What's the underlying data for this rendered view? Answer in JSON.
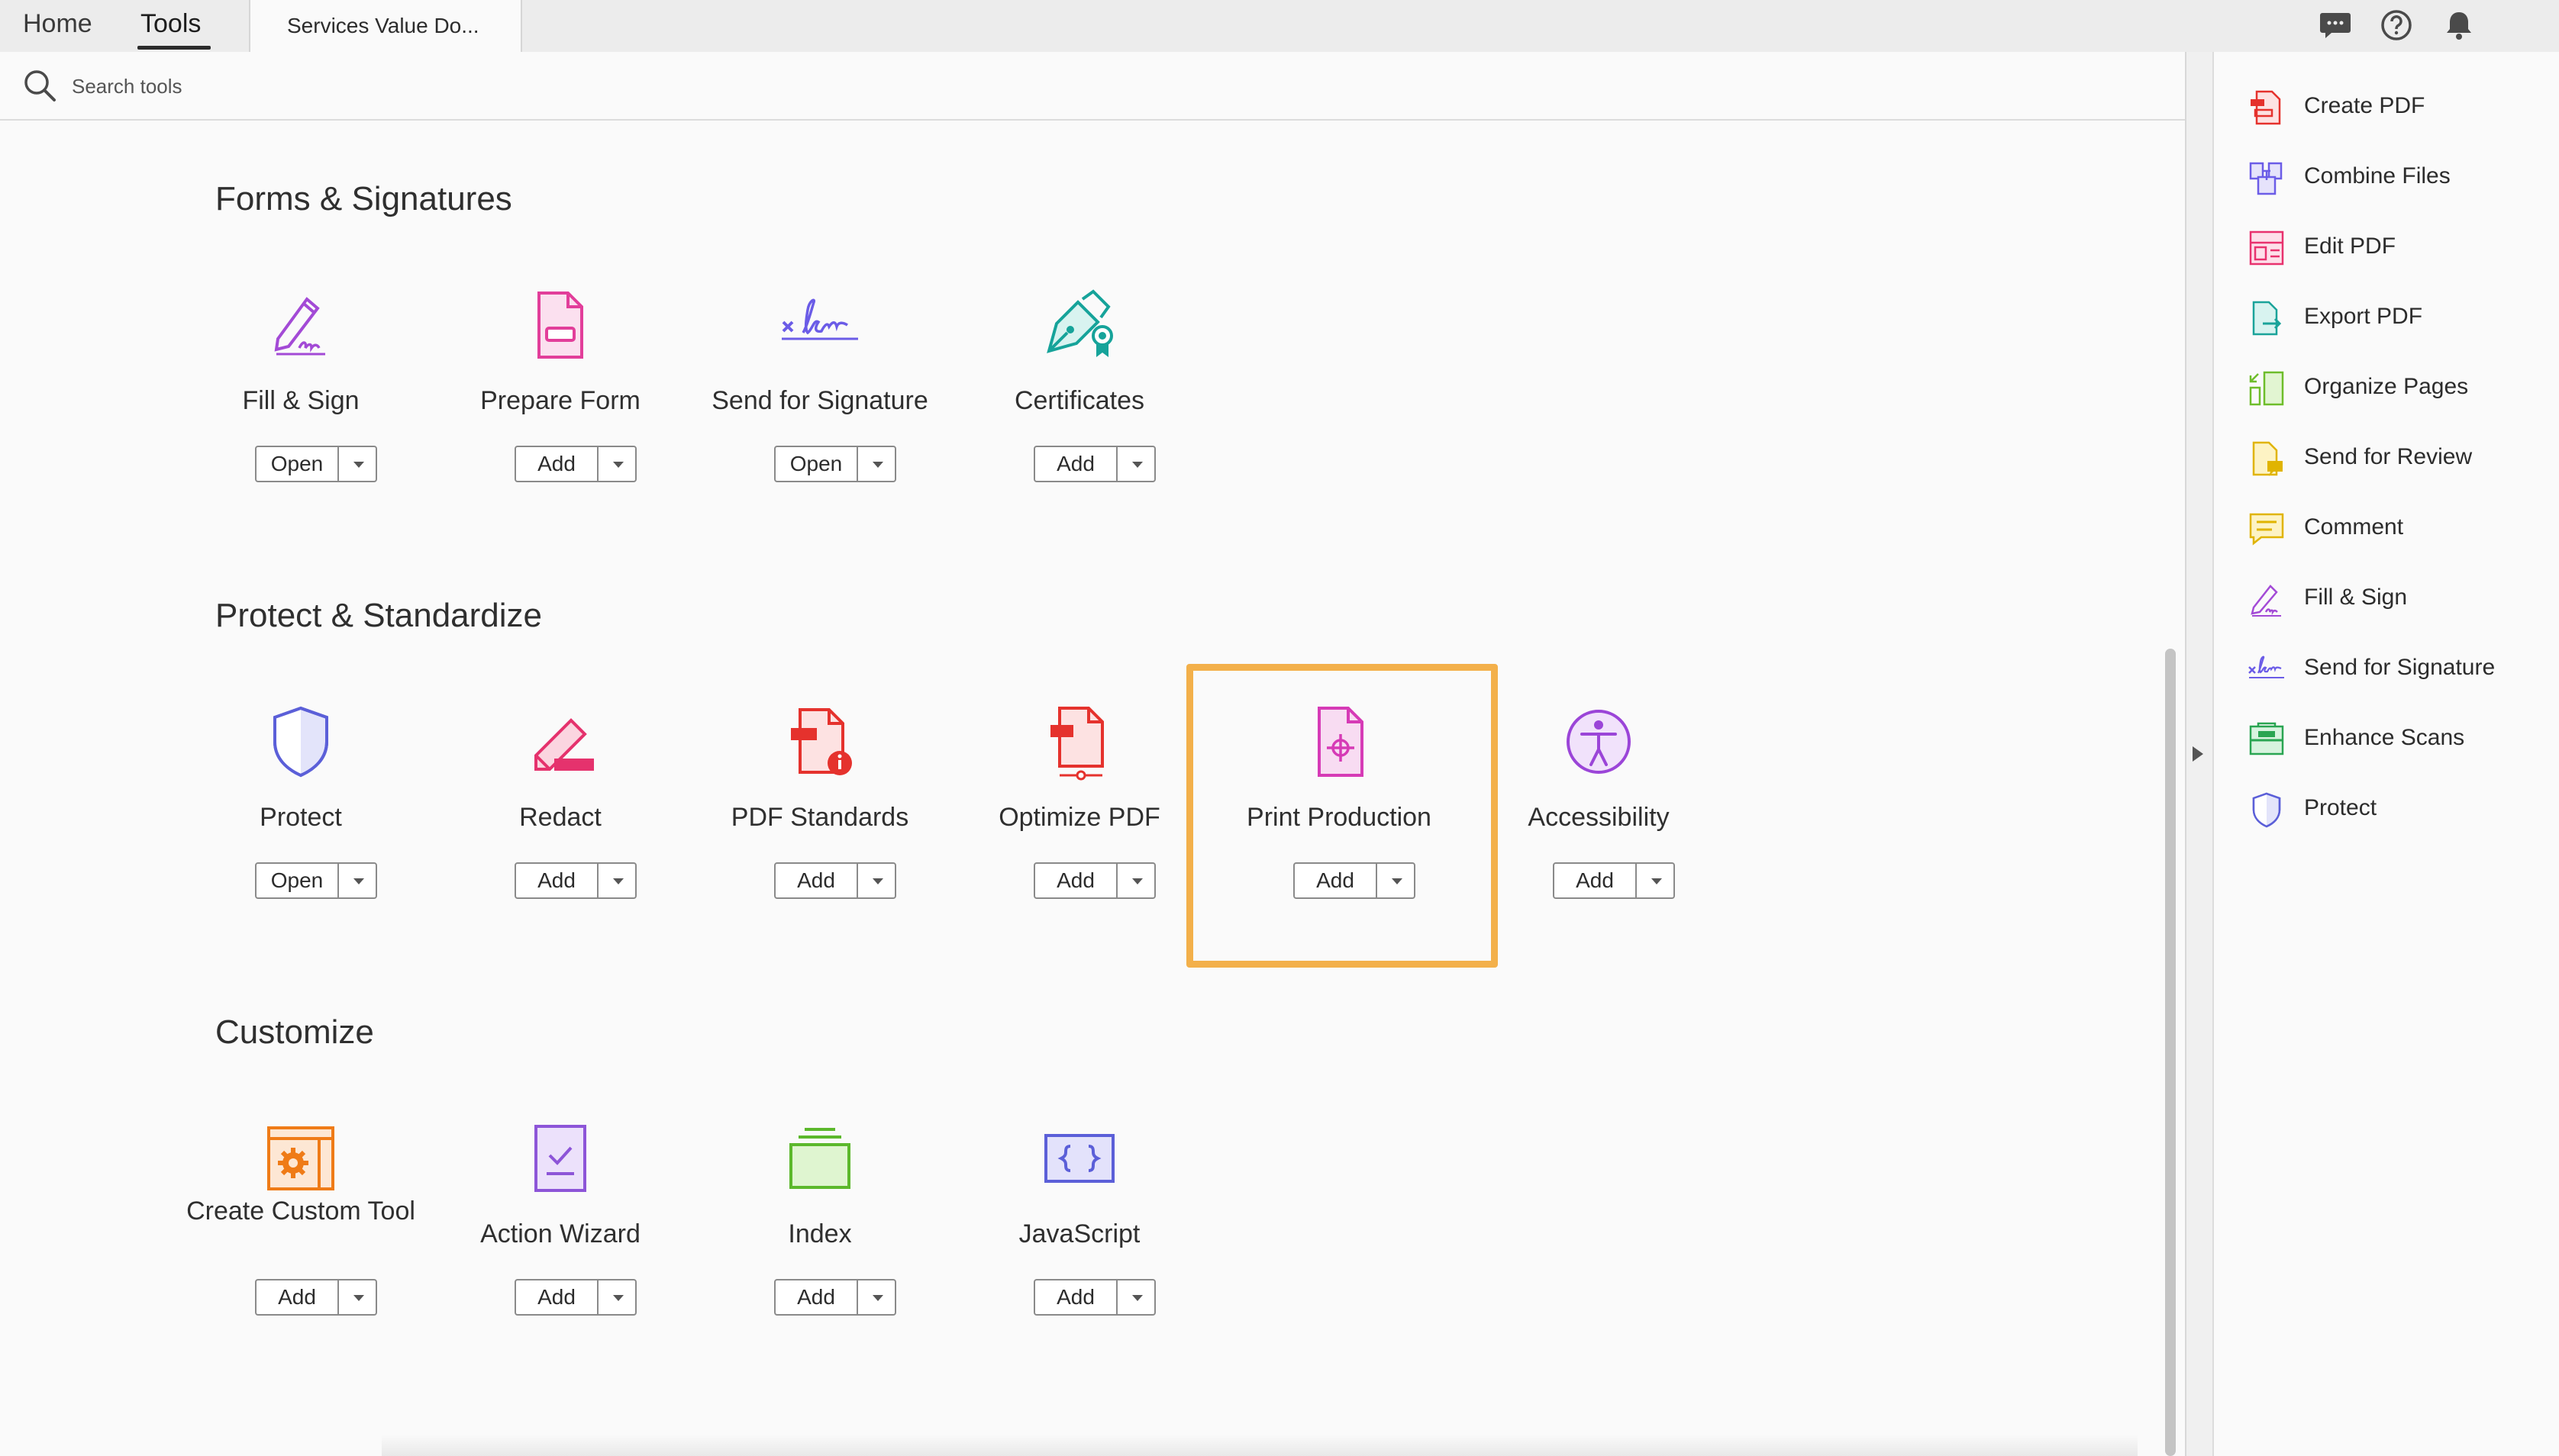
{
  "topbar": {
    "home_label": "Home",
    "tools_label": "Tools",
    "document_tab": "Services Value Do...",
    "icons": [
      "chat-icon",
      "help-icon",
      "bell-icon"
    ]
  },
  "search": {
    "placeholder": "Search tools"
  },
  "sections": [
    {
      "title": "Forms & Signatures",
      "tools": [
        {
          "name": "Fill & Sign",
          "button": "Open",
          "icon": "fill-sign-icon"
        },
        {
          "name": "Prepare Form",
          "button": "Add",
          "icon": "prepare-form-icon"
        },
        {
          "name": "Send for Signature",
          "button": "Open",
          "icon": "send-signature-icon"
        },
        {
          "name": "Certificates",
          "button": "Add",
          "icon": "certificates-icon"
        }
      ]
    },
    {
      "title": "Protect & Standardize",
      "tools": [
        {
          "name": "Protect",
          "button": "Open",
          "icon": "protect-icon"
        },
        {
          "name": "Redact",
          "button": "Add",
          "icon": "redact-icon"
        },
        {
          "name": "PDF Standards",
          "button": "Add",
          "icon": "pdf-standards-icon"
        },
        {
          "name": "Optimize PDF",
          "button": "Add",
          "icon": "optimize-pdf-icon"
        },
        {
          "name": "Print Production",
          "button": "Add",
          "icon": "print-production-icon"
        },
        {
          "name": "Accessibility",
          "button": "Add",
          "icon": "accessibility-icon"
        }
      ]
    },
    {
      "title": "Customize",
      "tools": [
        {
          "name": "Create Custom Tool",
          "button": "Add",
          "icon": "custom-tool-icon"
        },
        {
          "name": "Action Wizard",
          "button": "Add",
          "icon": "action-wizard-icon"
        },
        {
          "name": "Index",
          "button": "Add",
          "icon": "index-icon"
        },
        {
          "name": "JavaScript",
          "button": "Add",
          "icon": "javascript-icon"
        }
      ]
    }
  ],
  "right_panel": {
    "items": [
      {
        "label": "Create PDF",
        "icon": "create-pdf-icon",
        "color": "#e5322d"
      },
      {
        "label": "Combine Files",
        "icon": "combine-files-icon",
        "color": "#6b5ce7"
      },
      {
        "label": "Edit PDF",
        "icon": "edit-pdf-icon",
        "color": "#e8326e"
      },
      {
        "label": "Export PDF",
        "icon": "export-pdf-icon",
        "color": "#1aa39a"
      },
      {
        "label": "Organize Pages",
        "icon": "organize-pages-icon",
        "color": "#6ebd2b"
      },
      {
        "label": "Send for Review",
        "icon": "send-review-icon",
        "color": "#e0b400"
      },
      {
        "label": "Comment",
        "icon": "comment-icon",
        "color": "#e0b400"
      },
      {
        "label": "Fill & Sign",
        "icon": "fill-sign-icon",
        "color": "#a34ad6"
      },
      {
        "label": "Send for Signature",
        "icon": "send-signature-icon",
        "color": "#6b5ce7"
      },
      {
        "label": "Enhance Scans",
        "icon": "enhance-scans-icon",
        "color": "#2aa552"
      },
      {
        "label": "Protect",
        "icon": "protect-icon",
        "color": "#5b5fd8"
      }
    ]
  }
}
